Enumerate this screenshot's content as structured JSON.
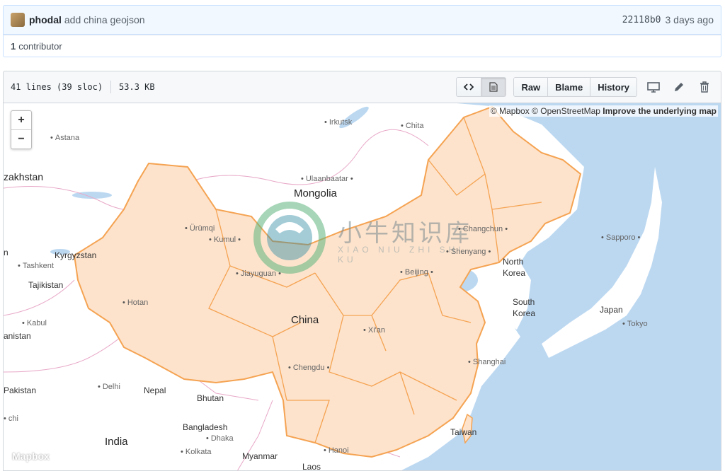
{
  "commit": {
    "author": "phodal",
    "message": "add china geojson",
    "sha": "22118b0",
    "time_ago": "3 days ago"
  },
  "contributors": {
    "count": "1",
    "label": "contributor"
  },
  "file": {
    "lines": "41 lines (39 sloc)",
    "size": "53.3 KB"
  },
  "toolbar": {
    "code_icon": "code-icon",
    "doc_icon": "file-icon",
    "raw": "Raw",
    "blame": "Blame",
    "history": "History",
    "desktop_icon": "desktop-icon",
    "edit_icon": "pencil-icon",
    "delete_icon": "trash-icon"
  },
  "map": {
    "attribution_mapbox": "© Mapbox",
    "attribution_osm": "© OpenStreetMap",
    "improve": "Improve the underlying map",
    "zoom_in": "+",
    "zoom_out": "−",
    "logo": "Mapbox",
    "colors": {
      "water": "#bcd8f1",
      "land": "#ffffff",
      "fill": "#fde3cc",
      "stroke": "#f5a352"
    },
    "labels": {
      "astana": "Astana",
      "irkutsk": "Irkutsk",
      "chita": "Chita",
      "kazakhstan": "zakhstan",
      "ulaanbaatar": "Ulaanbaatar",
      "mongolia": "Mongolia",
      "urumqi": "Ürümqi",
      "kumul": "Kumul",
      "kyrgyzstan": "Kyrgyzstan",
      "tashkent": "Tashkent",
      "tajikistan": "Tajikistan",
      "jiayuguan": "Jiayuguan",
      "changchun": "Changchun",
      "shenyang": "Shenyang",
      "beijing": "Beijing",
      "north_korea_1": "North",
      "north_korea_2": "Korea",
      "south_korea_1": "South",
      "south_korea_2": "Korea",
      "sapporo": "Sapporo",
      "japan": "Japan",
      "tokyo": "Tokyo",
      "hotan": "Hotan",
      "kabul": "Kabul",
      "anistan": "anistan",
      "china": "China",
      "xian": "Xi'an",
      "chengdu": "Chengdu",
      "shanghai": "Shanghai",
      "pakistan": "Pakistan",
      "delhi": "Delhi",
      "nepal": "Nepal",
      "bhutan": "Bhutan",
      "bangladesh": "Bangladesh",
      "dhaka": "Dhaka",
      "kolkata": "Kolkata",
      "india": "India",
      "myanmar": "Myanmar",
      "hanoi": "Hanoi",
      "laos": "Laos",
      "taiwan": "Taiwan",
      "n": "n",
      "chi": "chi"
    },
    "watermark_cn": "小牛知识库",
    "watermark_en": "XIAO NIU ZHI SHI KU"
  }
}
